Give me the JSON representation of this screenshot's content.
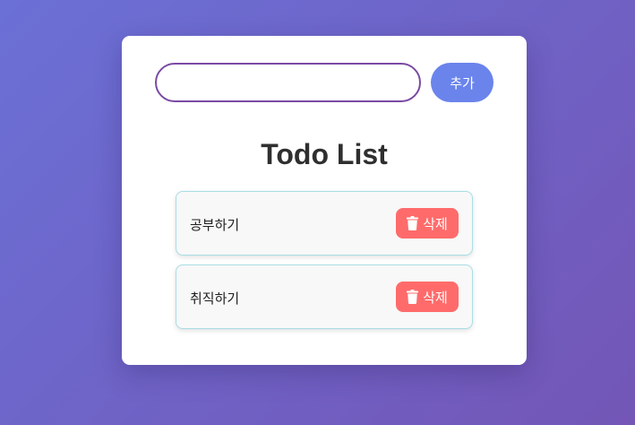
{
  "input": {
    "value": "",
    "placeholder": ""
  },
  "add_button": {
    "label": "추가"
  },
  "title": "Todo List",
  "todos": [
    {
      "text": "공부하기",
      "delete_label": "삭제",
      "delete_icon": "trash-icon"
    },
    {
      "text": "취직하기",
      "delete_label": "삭제",
      "delete_icon": "trash-icon"
    }
  ],
  "colors": {
    "background_start": "#6b70d6",
    "background_end": "#7356b6",
    "add_button": "#6a84ec",
    "delete_button": "#ff6b6b",
    "input_border": "#7a4aa3",
    "item_border": "#a9dde5"
  }
}
